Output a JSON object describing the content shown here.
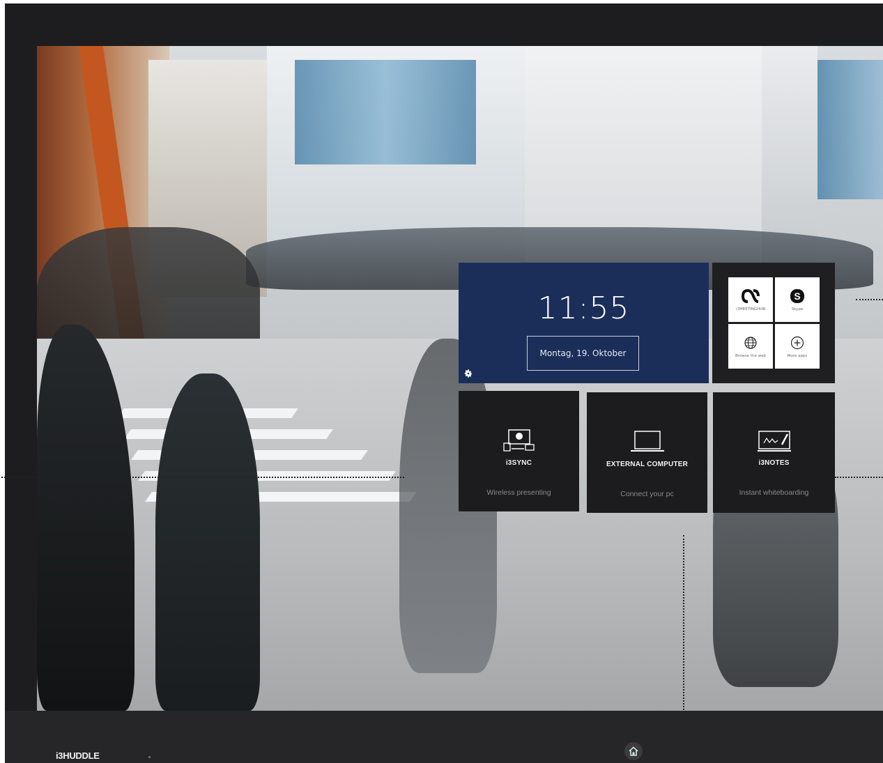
{
  "clock": {
    "time": "11:55",
    "date": "Montag, 19. Oktober"
  },
  "apps": [
    {
      "name": "i3MEETINGHUB",
      "icon": "meetinghub-icon"
    },
    {
      "name": "Skype",
      "icon": "skype-icon"
    },
    {
      "name": "Browse the web",
      "icon": "globe-icon"
    },
    {
      "name": "More apps",
      "icon": "plus-circle-icon"
    }
  ],
  "tiles": [
    {
      "title": "i3SYNC",
      "subtitle": "Wireless presenting",
      "icon": "sync-devices-icon"
    },
    {
      "title": "EXTERNAL COMPUTER",
      "subtitle": "Connect your pc",
      "icon": "laptop-icon"
    },
    {
      "title": "i3NOTES",
      "subtitle": "Instant whiteboarding",
      "icon": "whiteboard-icon"
    }
  ],
  "footer": {
    "brand": "i3HUDDLE",
    "home_icon": "home-icon"
  },
  "colors": {
    "clock_tile": "#1b2e59",
    "tile": "#1c1c1e",
    "bezel": "#1d1d1f"
  }
}
